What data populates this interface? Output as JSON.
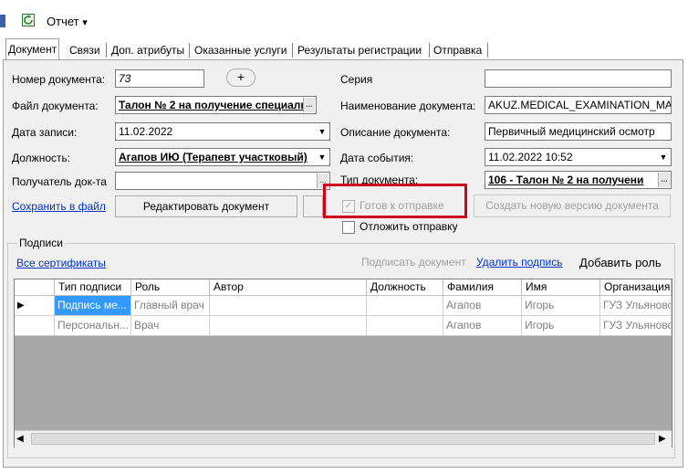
{
  "toolbar": {
    "report_label": "Отчет",
    "report_arrow": "▾"
  },
  "tabs": [
    {
      "label": "Документ",
      "active": true
    },
    {
      "label": "Связи"
    },
    {
      "label": "Доп. атрибуты"
    },
    {
      "label": "Оказанные услуги"
    },
    {
      "label": "Результаты регистрации"
    },
    {
      "label": "Отправка"
    }
  ],
  "form": {
    "doc_number_label": "Номер документа:",
    "doc_number_value": "73",
    "plus_label": "+",
    "series_label": "Серия",
    "series_value": "",
    "file_label": "Файл документа:",
    "file_value": "Талон № 2 на получение специаль",
    "doc_name_label": "Наименование документа:",
    "doc_name_value": "AKUZ.MEDICAL_EXAMINATION_MAI",
    "record_date_label": "Дата записи:",
    "record_date_value": "11.02.2022",
    "description_label": "Описание документа:",
    "description_value": "Первичный медицинский осмотр",
    "position_label": "Должность:",
    "position_value": "Агапов ИЮ (Терапевт участковый)",
    "event_date_label": "Дата события:",
    "event_date_value": "11.02.2022 10:52",
    "recipient_label": "Получатель док-та",
    "recipient_value": "",
    "doc_type_label": "Тип документа:",
    "doc_type_value": "106 - Талон № 2 на получени"
  },
  "actions": {
    "save_to_file": "Сохранить в файл",
    "edit_document": "Редактировать документ",
    "ready_to_send": "Готов к отправке",
    "postpone_send": "Отложить отправку",
    "new_version": "Создать новую версию документа"
  },
  "signatures": {
    "group_title": "Подписи",
    "all_certificates": "Все сертификаты",
    "sign_document": "Подписать документ",
    "delete_signature": "Удалить подпись",
    "add_role": "Добавить роль",
    "columns": [
      "Тип подписи",
      "Роль",
      "Автор",
      "Должность",
      "Фамилия",
      "Имя",
      "Организация"
    ],
    "rows": [
      {
        "type": "Подпись ме...",
        "role": "Главный врач",
        "author": "",
        "position": "",
        "surname": "Агапов",
        "name": "Игорь",
        "org": "ГУЗ Ульяновс"
      },
      {
        "type": "Персональн...",
        "role": "Врач",
        "author": "",
        "position": "",
        "surname": "Агапов",
        "name": "Игорь",
        "org": "ГУЗ Ульяновс"
      }
    ]
  },
  "colors": {
    "highlight_box": "#d0021b",
    "link": "#0033cc",
    "selection": "#3399ff"
  }
}
